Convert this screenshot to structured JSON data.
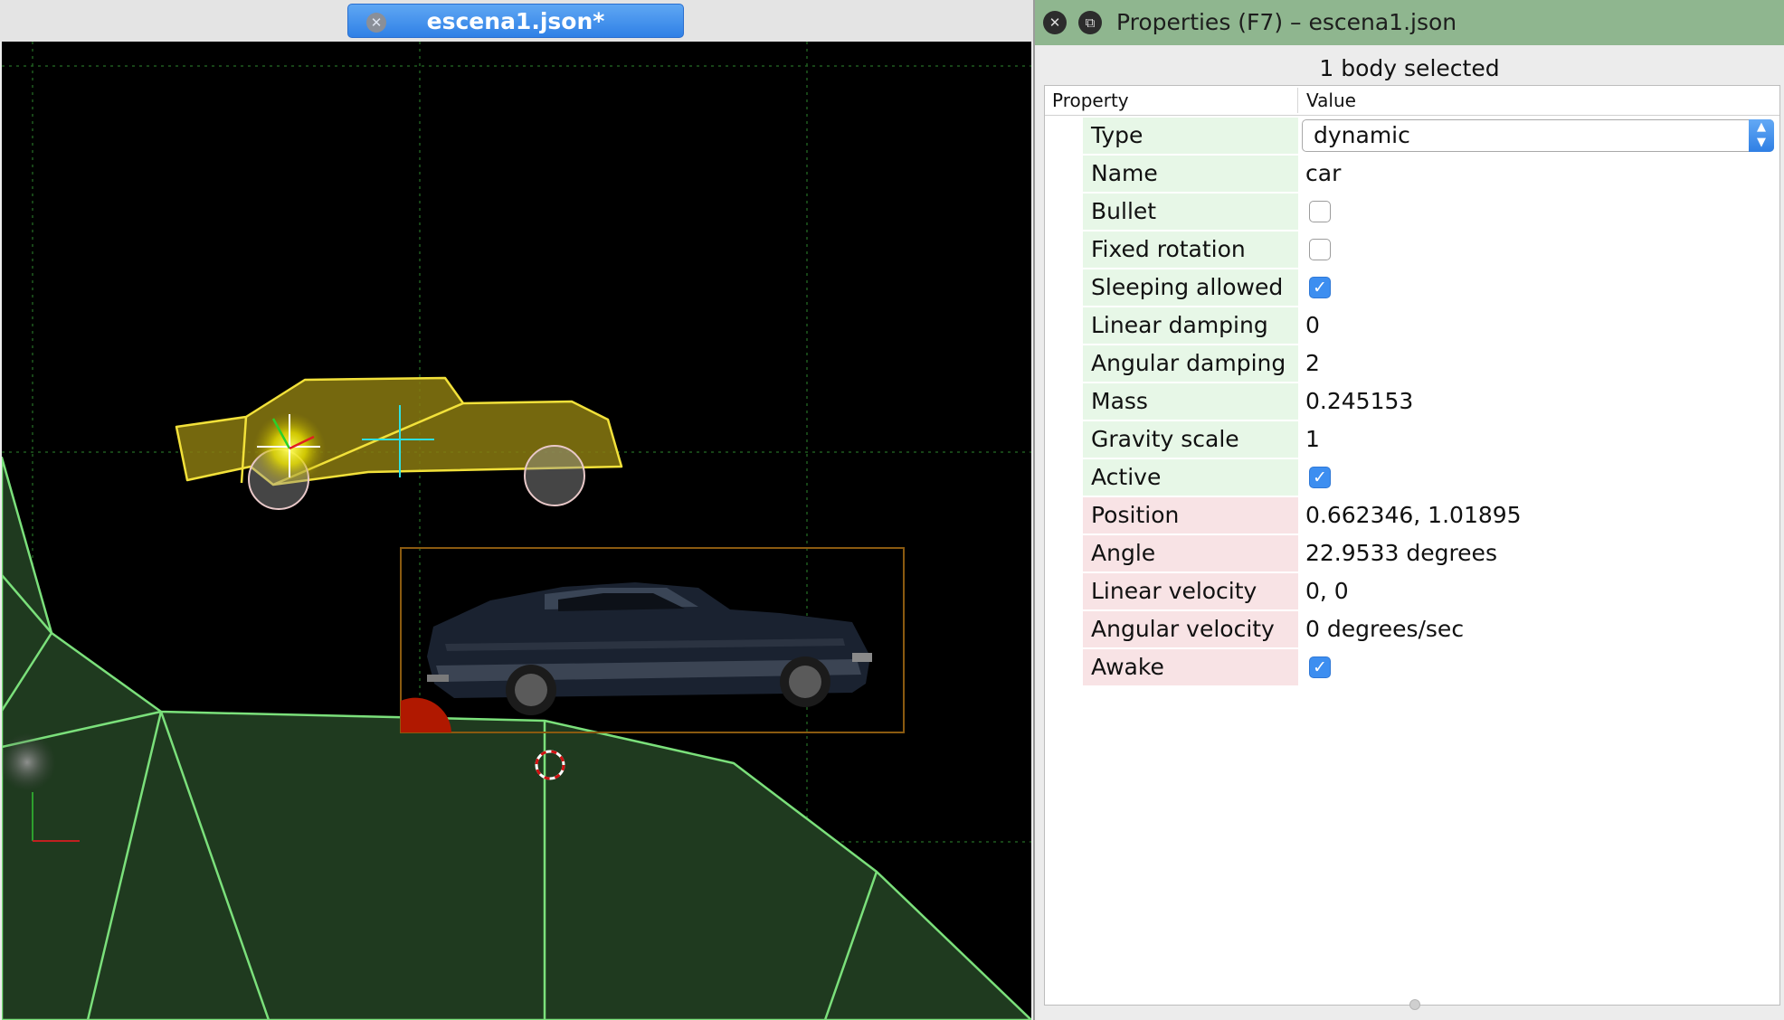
{
  "editor": {
    "tab_title": "escena1.json*",
    "tab_close_icon": "close-icon"
  },
  "properties_panel": {
    "title": "Properties (F7) – escena1.json",
    "close_icon": "close-icon",
    "float_icon": "float-window-icon",
    "selection_label": "1 body selected",
    "columns": {
      "property": "Property",
      "value": "Value"
    },
    "rows": [
      {
        "name": "Type",
        "value": "dynamic",
        "kind": "select",
        "group": "green"
      },
      {
        "name": "Name",
        "value": "car",
        "kind": "text",
        "group": "green"
      },
      {
        "name": "Bullet",
        "checked": false,
        "kind": "checkbox",
        "group": "green"
      },
      {
        "name": "Fixed rotation",
        "checked": false,
        "kind": "checkbox",
        "group": "green"
      },
      {
        "name": "Sleeping allowed",
        "checked": true,
        "kind": "checkbox",
        "group": "green"
      },
      {
        "name": "Linear damping",
        "value": "0",
        "kind": "text",
        "group": "green"
      },
      {
        "name": "Angular damping",
        "value": "2",
        "kind": "text",
        "group": "green"
      },
      {
        "name": "Mass",
        "value": "0.245153",
        "kind": "text",
        "group": "green"
      },
      {
        "name": "Gravity scale",
        "value": "1",
        "kind": "text",
        "group": "green"
      },
      {
        "name": "Active",
        "checked": true,
        "kind": "checkbox",
        "group": "green"
      },
      {
        "name": "Position",
        "value": "0.662346, 1.01895",
        "kind": "text",
        "group": "pink"
      },
      {
        "name": "Angle",
        "value": "22.9533 degrees",
        "kind": "text",
        "group": "pink"
      },
      {
        "name": "Linear velocity",
        "value": "0, 0",
        "kind": "text",
        "group": "pink"
      },
      {
        "name": "Angular velocity",
        "value": "0 degrees/sec",
        "kind": "text",
        "group": "pink"
      },
      {
        "name": "Awake",
        "checked": true,
        "kind": "checkbox",
        "group": "pink"
      }
    ]
  },
  "colors": {
    "titlebar_green": "#8fb68f",
    "tab_blue": "#2f80e6",
    "static_fixture_fill": "#1f3a1f",
    "static_fixture_edge": "#7be07b",
    "selected_body_fill": "#8a7a10",
    "selected_body_edge": "#f2e13a",
    "checkbox_checked": "#3d8ef0"
  }
}
